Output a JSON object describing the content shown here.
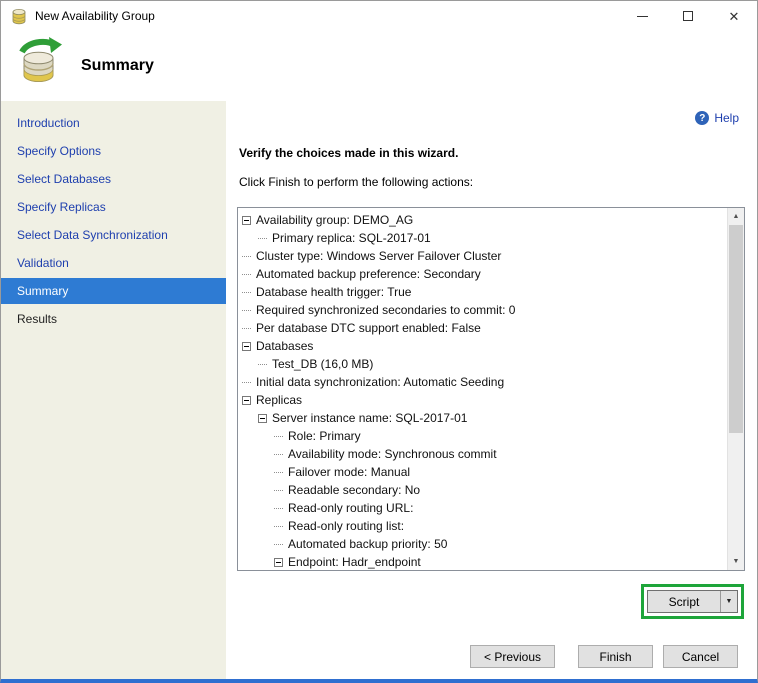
{
  "window": {
    "title": "New Availability Group"
  },
  "header": {
    "title": "Summary"
  },
  "sidebar": {
    "items": [
      {
        "label": "Introduction",
        "state": "link"
      },
      {
        "label": "Specify Options",
        "state": "link"
      },
      {
        "label": "Select Databases",
        "state": "link"
      },
      {
        "label": "Specify Replicas",
        "state": "link"
      },
      {
        "label": "Select Data Synchronization",
        "state": "link"
      },
      {
        "label": "Validation",
        "state": "link"
      },
      {
        "label": "Summary",
        "state": "selected"
      },
      {
        "label": "Results",
        "state": "plain"
      }
    ]
  },
  "main": {
    "help_label": "Help",
    "heading": "Verify the choices made in this wizard.",
    "instruction": "Click Finish to perform the following actions:",
    "tree": [
      {
        "label": "Availability group: DEMO_AG",
        "indent": 0,
        "expandable": true
      },
      {
        "label": "Primary replica: SQL-2017-01",
        "indent": 1,
        "expandable": false
      },
      {
        "label": "Cluster type: Windows Server Failover Cluster",
        "indent": 0,
        "expandable": false
      },
      {
        "label": "Automated backup preference: Secondary",
        "indent": 0,
        "expandable": false
      },
      {
        "label": "Database health trigger: True",
        "indent": 0,
        "expandable": false
      },
      {
        "label": "Required synchronized secondaries to commit: 0",
        "indent": 0,
        "expandable": false
      },
      {
        "label": "Per database DTC support enabled: False",
        "indent": 0,
        "expandable": false
      },
      {
        "label": "Databases",
        "indent": 0,
        "expandable": true
      },
      {
        "label": "Test_DB (16,0 MB)",
        "indent": 1,
        "expandable": false
      },
      {
        "label": "Initial data synchronization: Automatic Seeding",
        "indent": 0,
        "expandable": false
      },
      {
        "label": "Replicas",
        "indent": 0,
        "expandable": true
      },
      {
        "label": "Server instance name: SQL-2017-01",
        "indent": 1,
        "expandable": true
      },
      {
        "label": "Role: Primary",
        "indent": 2,
        "expandable": false
      },
      {
        "label": "Availability mode: Synchronous commit",
        "indent": 2,
        "expandable": false
      },
      {
        "label": "Failover mode: Manual",
        "indent": 2,
        "expandable": false
      },
      {
        "label": "Readable secondary: No",
        "indent": 2,
        "expandable": false
      },
      {
        "label": "Read-only routing URL:",
        "indent": 2,
        "expandable": false
      },
      {
        "label": "Read-only routing list:",
        "indent": 2,
        "expandable": false
      },
      {
        "label": "Automated backup priority: 50",
        "indent": 2,
        "expandable": false
      },
      {
        "label": "Endpoint: Hadr_endpoint",
        "indent": 2,
        "expandable": true
      }
    ]
  },
  "buttons": {
    "script": "Script",
    "previous": "< Previous",
    "finish": "Finish",
    "cancel": "Cancel"
  },
  "colors": {
    "sidebar_bg": "#f0f0e4",
    "selected_step_bg": "#2e7bd3",
    "link_blue": "#1e3fae",
    "annotation_green": "#1ea53a",
    "window_accent": "#2f6fd0",
    "button_bg": "#e1e1e1"
  }
}
